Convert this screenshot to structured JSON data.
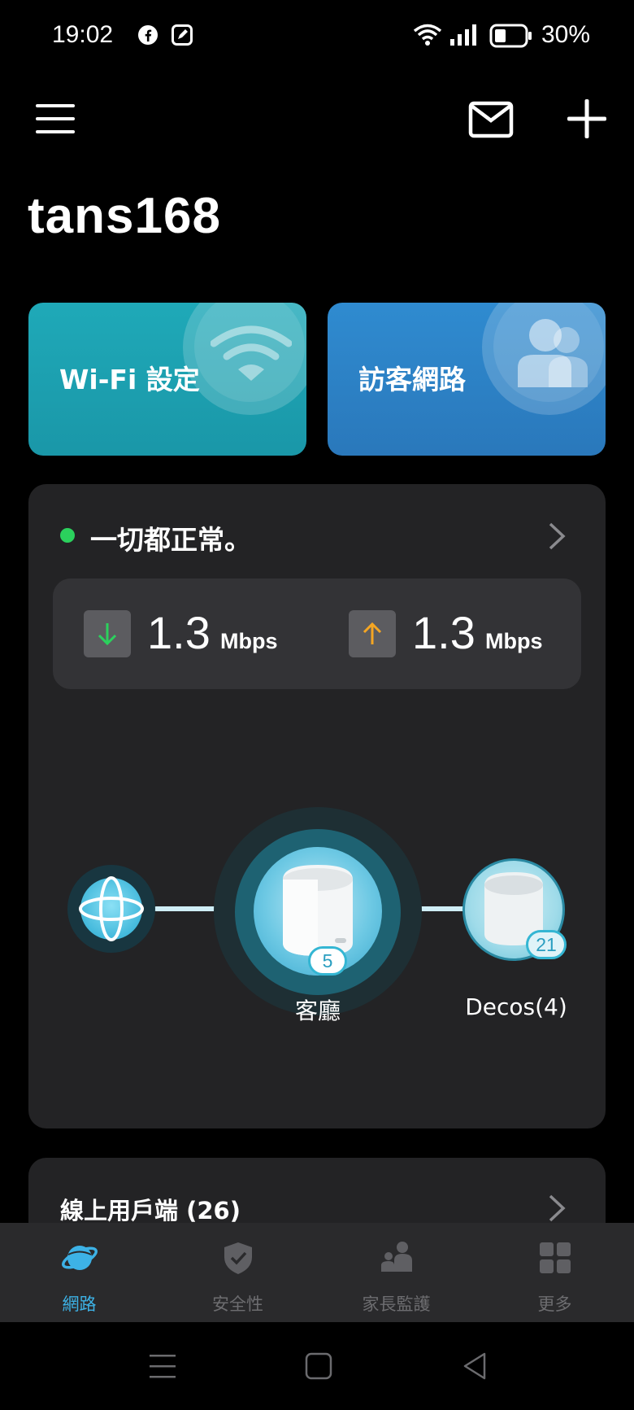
{
  "status_bar": {
    "time": "19:02",
    "battery": "30%"
  },
  "header": {
    "network_name": "tans168"
  },
  "cards": {
    "wifi": "Wi-Fi 設定",
    "guest": "訪客網路"
  },
  "status": {
    "text": "一切都正常。"
  },
  "speed": {
    "download_value": "1.3",
    "download_unit": "Mbps",
    "upload_value": "1.3",
    "upload_unit": "Mbps"
  },
  "topology": {
    "main_node_label": "客廳",
    "main_node_count": "5",
    "satellite_label": "Decos(4)",
    "satellite_count": "21"
  },
  "clients": {
    "label": "線上用戶端 (26)"
  },
  "nav": {
    "items": [
      {
        "label": "網路",
        "icon": "planet-icon",
        "active": true
      },
      {
        "label": "安全性",
        "icon": "shield-icon",
        "active": false
      },
      {
        "label": "家長監護",
        "icon": "family-icon",
        "active": false
      },
      {
        "label": "更多",
        "icon": "grid-icon",
        "active": false
      }
    ]
  },
  "colors": {
    "accent": "#3db2e6",
    "ok": "#2bd15d",
    "download": "#2bd15d",
    "upload": "#f5a623"
  }
}
